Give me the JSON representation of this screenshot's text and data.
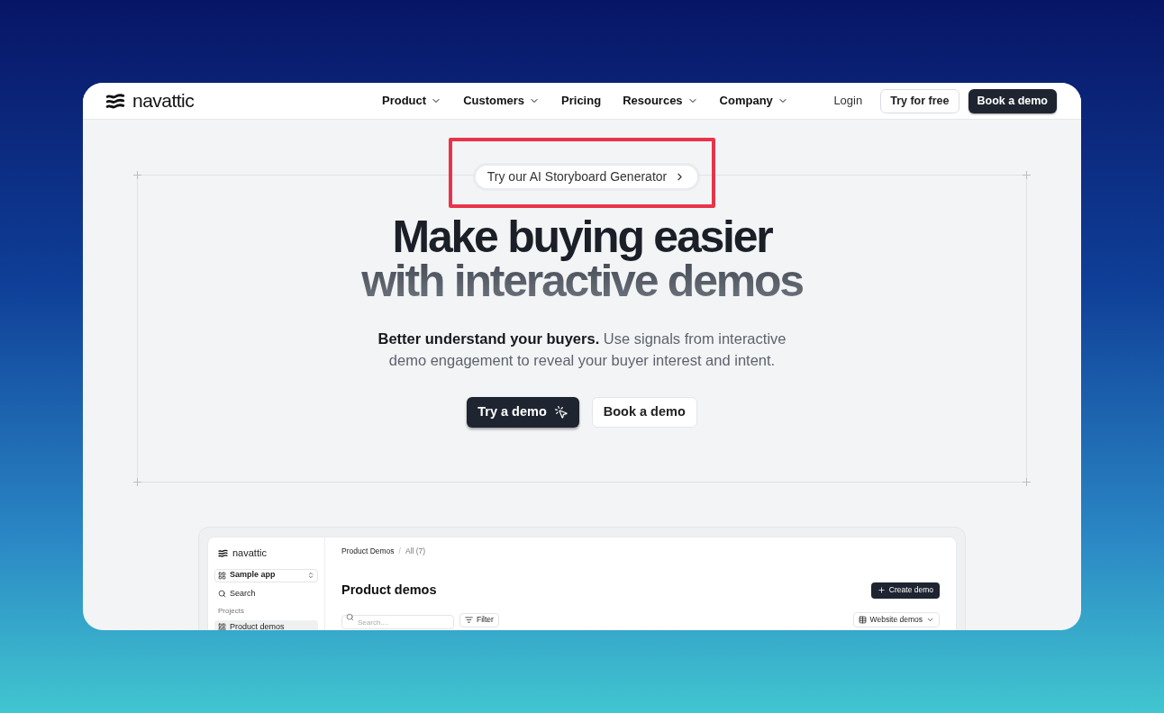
{
  "nav": {
    "logo": "navattic",
    "links": [
      {
        "label": "Product",
        "dropdown": true
      },
      {
        "label": "Customers",
        "dropdown": true
      },
      {
        "label": "Pricing",
        "dropdown": false
      },
      {
        "label": "Resources",
        "dropdown": true
      },
      {
        "label": "Company",
        "dropdown": true
      }
    ],
    "login": "Login",
    "try_free": "Try for free",
    "book_demo": "Book a demo"
  },
  "hero": {
    "badge": "Try our AI Storyboard Generator",
    "badge_highlighted": true,
    "headline": [
      "Make buying easier",
      "with interactive demos"
    ],
    "subtitle": "**Better understand your buyers.** Use signals from interactive demo engagement to reveal your buyer interest and intent.",
    "buttons": [
      {
        "label": "Try a demo",
        "kind": "primary"
      },
      {
        "label": "Book a demo",
        "kind": "secondary"
      }
    ]
  },
  "preview": {
    "logo": "navattic",
    "app_select": "Sample app",
    "search": "Search",
    "section_label": "Projects",
    "projects": [
      {
        "label": "Product demos",
        "selected": true
      }
    ],
    "breadcrumb": [
      "Product Demos",
      "/",
      "All (7)"
    ],
    "title": "Product demos",
    "create_button": "Create demo",
    "search_placeholder": "Search....",
    "filter": "Filter",
    "view_select": "Website demos"
  }
}
